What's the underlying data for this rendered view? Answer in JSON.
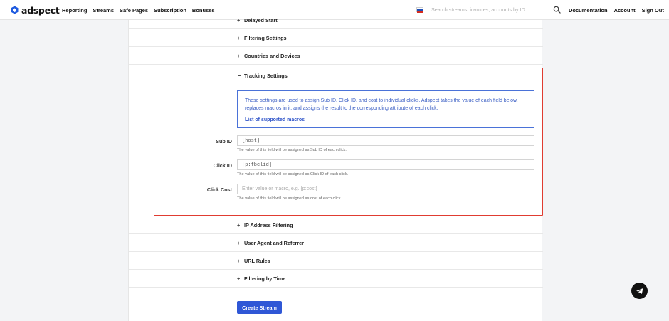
{
  "brand": {
    "name": "adspect"
  },
  "nav": {
    "links": [
      "Reporting",
      "Streams",
      "Safe Pages",
      "Subscription",
      "Bonuses"
    ],
    "search_placeholder": "Search streams, invoices, accounts by ID",
    "right_links": [
      "Documentation",
      "Account",
      "Sign Out"
    ],
    "flag": "russia-flag-icon"
  },
  "sections_top": [
    {
      "sign": "+",
      "label": "Delayed Start"
    },
    {
      "sign": "+",
      "label": "Filtering Settings"
    },
    {
      "sign": "+",
      "label": "Countries and Devices"
    }
  ],
  "tracking": {
    "sign": "−",
    "title": "Tracking Settings",
    "info_text": "These settings are used to assign Sub ID, Click ID, and cost to individual clicks. Adspect takes the value of each field below, replaces macros in it, and assigns the result to the corresponding attribute of each click.",
    "info_link": "List of supported macros",
    "fields": [
      {
        "label": "Sub ID",
        "value": "[host]",
        "placeholder": "",
        "help": "The value of this field will be assigned as Sub ID of each click."
      },
      {
        "label": "Click ID",
        "value": "[p:fbclid]",
        "placeholder": "",
        "help": "The value of this field will be assigned as Click ID of each click."
      },
      {
        "label": "Click Cost",
        "value": "",
        "placeholder": "Enter value or macro, e.g. {p:cost}",
        "help": "The value of this field will be assigned as cost of each click."
      }
    ]
  },
  "sections_bottom": [
    {
      "sign": "+",
      "label": "IP Address Filtering"
    },
    {
      "sign": "+",
      "label": "User Agent and Referrer"
    },
    {
      "sign": "+",
      "label": "URL Rules"
    },
    {
      "sign": "+",
      "label": "Filtering by Time"
    }
  ],
  "create_button": "Create Stream",
  "colors": {
    "accent": "#2f57d6",
    "highlight_border": "#e03c31",
    "info_text": "#3b5fc4"
  }
}
